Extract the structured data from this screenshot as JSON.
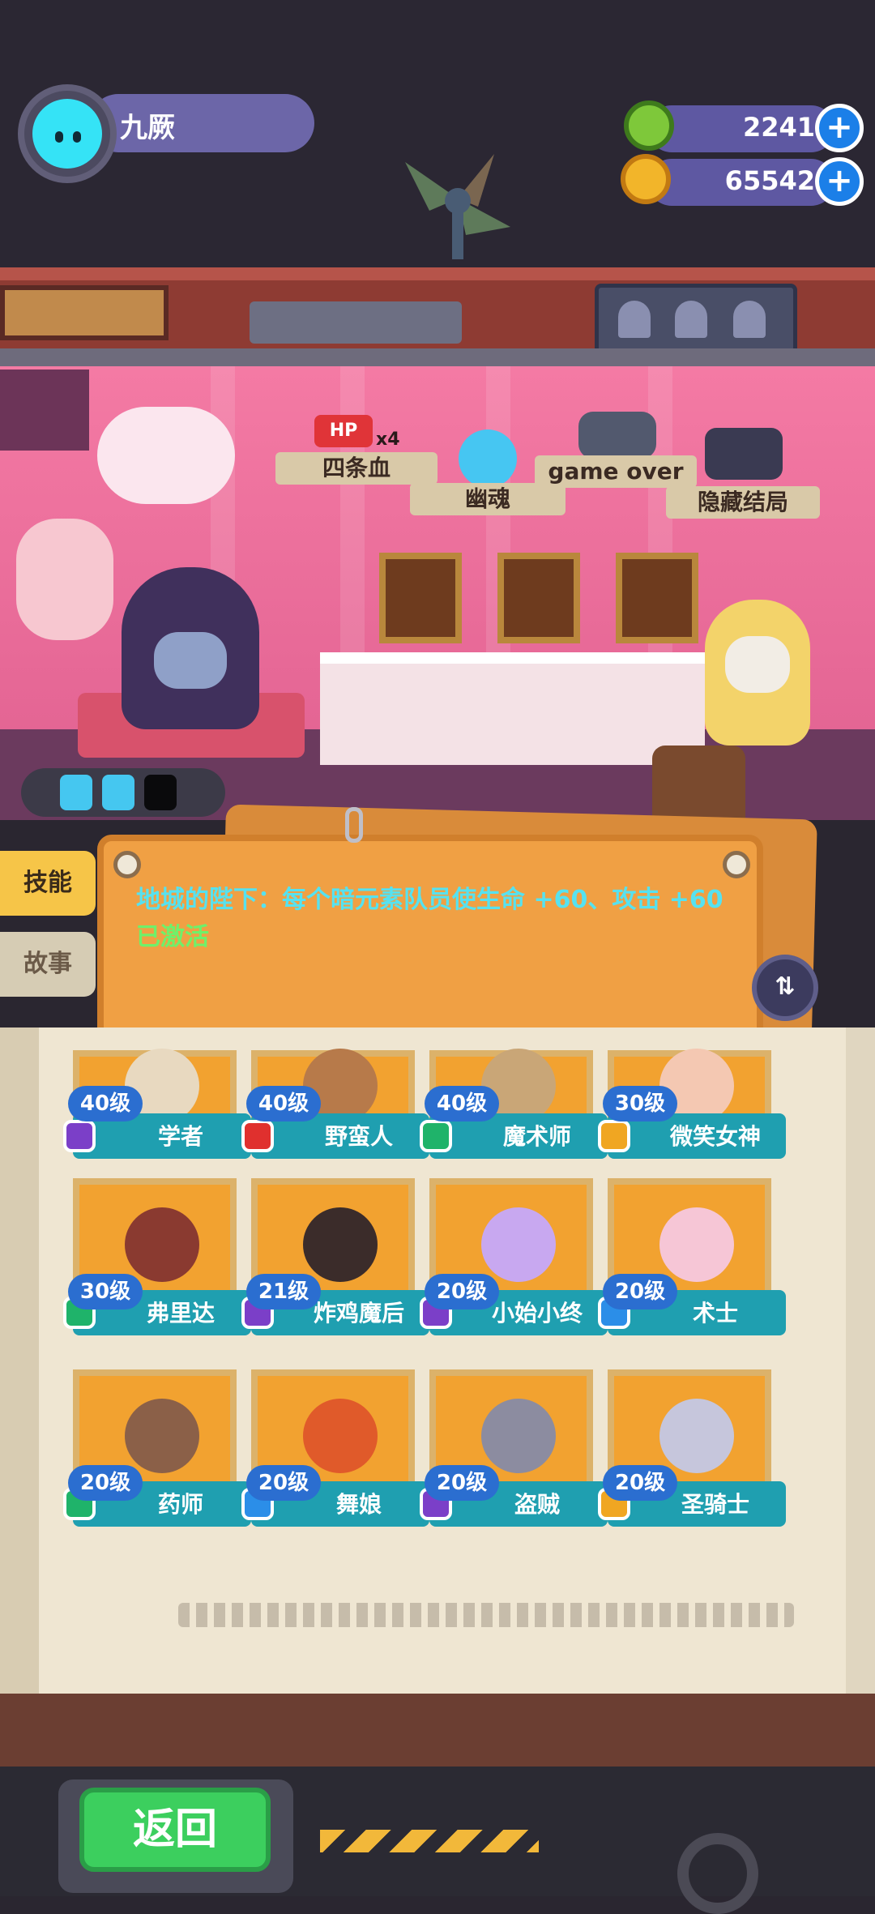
{
  "player": {
    "name": "九厥",
    "avatar_icon": "cat-face-avatar-icon"
  },
  "currencies": [
    {
      "icon": "green-coin-icon",
      "value": "2241",
      "plus": "+"
    },
    {
      "icon": "planet-gold-icon",
      "value": "65542",
      "plus": "+"
    }
  ],
  "achievements": {
    "banner1": "四条血",
    "badge1": "HP",
    "badge1_count": "x4",
    "banner2": "幽魂",
    "banner3": "game over",
    "banner4": "隐藏结局"
  },
  "energy": {
    "charges_filled": 2,
    "charges_total": 3
  },
  "side_tabs": {
    "skills": "技能",
    "story": "故事"
  },
  "skill": {
    "description": "地城的陛下：每个暗元素队员使生命 +60、攻击 +60",
    "status": "已激活"
  },
  "characters": [
    {
      "name": "学者",
      "level": "40级",
      "badge_color": "#7b3fc8",
      "face_color": "#e8d9c0"
    },
    {
      "name": "野蛮人",
      "level": "40级",
      "badge_color": "#e0302e",
      "face_color": "#b77a4a"
    },
    {
      "name": "魔术师",
      "level": "40级",
      "badge_color": "#1fb36a",
      "face_color": "#c9a677"
    },
    {
      "name": "微笑女神",
      "level": "30级",
      "badge_color": "#f0a622",
      "face_color": "#f4c8b2"
    },
    {
      "name": "弗里达",
      "level": "30级",
      "badge_color": "#1fb36a",
      "face_color": "#8a3a30"
    },
    {
      "name": "炸鸡魔后",
      "level": "21级",
      "badge_color": "#7b3fc8",
      "face_color": "#3b2c2a"
    },
    {
      "name": "小始小终",
      "level": "20级",
      "badge_color": "#7b3fc8",
      "face_color": "#c8a8f0"
    },
    {
      "name": "术士",
      "level": "20级",
      "badge_color": "#2b8ee8",
      "face_color": "#f6c6d6"
    },
    {
      "name": "药师",
      "level": "20级",
      "badge_color": "#1fb36a",
      "face_color": "#8b6048"
    },
    {
      "name": "舞娘",
      "level": "20级",
      "badge_color": "#2b8ee8",
      "face_color": "#e05a2a"
    },
    {
      "name": "盗贼",
      "level": "20级",
      "badge_color": "#7b3fc8",
      "face_color": "#8c8ca0"
    },
    {
      "name": "圣骑士",
      "level": "20级",
      "badge_color": "#f0a622",
      "face_color": "#c6c6dc"
    }
  ],
  "back_button": "返回"
}
